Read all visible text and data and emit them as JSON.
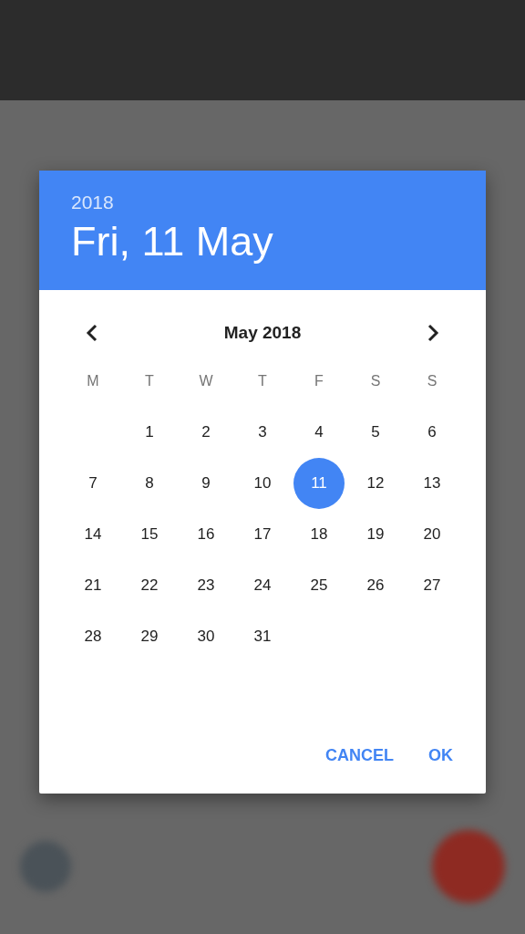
{
  "header": {
    "year": "2018",
    "date": "Fri, 11 May"
  },
  "calendar": {
    "month": "May 2018",
    "weekdays": [
      "M",
      "T",
      "W",
      "T",
      "F",
      "S",
      "S"
    ],
    "weeks": [
      [
        {
          "kind": "empty"
        },
        {
          "kind": "day",
          "label": "1",
          "selected": false
        },
        {
          "kind": "day",
          "label": "2",
          "selected": false
        },
        {
          "kind": "day",
          "label": "3",
          "selected": false
        },
        {
          "kind": "day",
          "label": "4",
          "selected": false
        },
        {
          "kind": "day",
          "label": "5",
          "selected": false
        },
        {
          "kind": "day",
          "label": "6",
          "selected": false
        }
      ],
      [
        {
          "kind": "day",
          "label": "7",
          "selected": false
        },
        {
          "kind": "day",
          "label": "8",
          "selected": false
        },
        {
          "kind": "day",
          "label": "9",
          "selected": false
        },
        {
          "kind": "day",
          "label": "10",
          "selected": false
        },
        {
          "kind": "day",
          "label": "11",
          "selected": true
        },
        {
          "kind": "day",
          "label": "12",
          "selected": false
        },
        {
          "kind": "day",
          "label": "13",
          "selected": false
        }
      ],
      [
        {
          "kind": "day",
          "label": "14",
          "selected": false
        },
        {
          "kind": "day",
          "label": "15",
          "selected": false
        },
        {
          "kind": "day",
          "label": "16",
          "selected": false
        },
        {
          "kind": "day",
          "label": "17",
          "selected": false
        },
        {
          "kind": "day",
          "label": "18",
          "selected": false
        },
        {
          "kind": "day",
          "label": "19",
          "selected": false
        },
        {
          "kind": "day",
          "label": "20",
          "selected": false
        }
      ],
      [
        {
          "kind": "day",
          "label": "21",
          "selected": false
        },
        {
          "kind": "day",
          "label": "22",
          "selected": false
        },
        {
          "kind": "day",
          "label": "23",
          "selected": false
        },
        {
          "kind": "day",
          "label": "24",
          "selected": false
        },
        {
          "kind": "day",
          "label": "25",
          "selected": false
        },
        {
          "kind": "day",
          "label": "26",
          "selected": false
        },
        {
          "kind": "day",
          "label": "27",
          "selected": false
        }
      ],
      [
        {
          "kind": "day",
          "label": "28",
          "selected": false
        },
        {
          "kind": "day",
          "label": "29",
          "selected": false
        },
        {
          "kind": "day",
          "label": "30",
          "selected": false
        },
        {
          "kind": "day",
          "label": "31",
          "selected": false
        }
      ]
    ]
  },
  "buttons": [
    {
      "label": "CANCEL"
    },
    {
      "label": "OK"
    }
  ]
}
